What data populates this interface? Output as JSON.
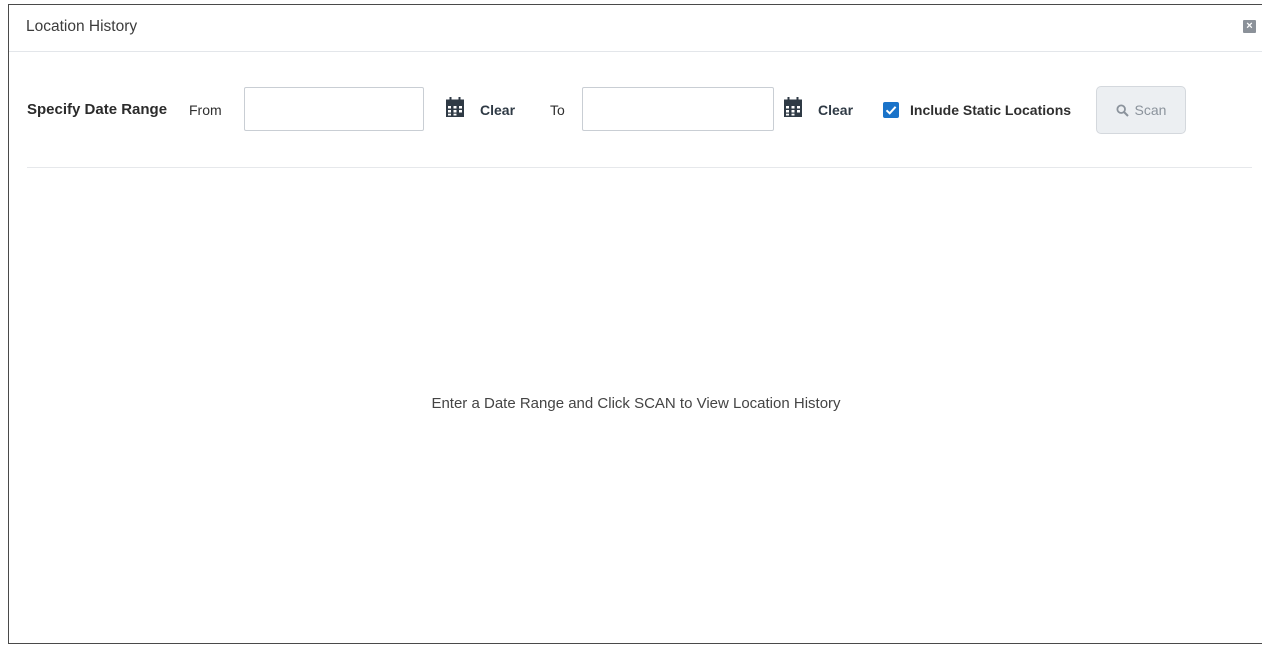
{
  "window": {
    "title": "Location History",
    "close_icon": "close-icon"
  },
  "filters": {
    "section_label": "Specify Date Range",
    "from_label": "From",
    "from_value": "",
    "from_placeholder": "",
    "to_label": "To",
    "to_value": "",
    "to_placeholder": "",
    "clear_label": "Clear",
    "calendar_icon": "calendar-icon",
    "include_static": {
      "label": "Include Static Locations",
      "checked": true
    },
    "scan_button": {
      "label": "Scan",
      "icon": "search-icon",
      "enabled": false
    }
  },
  "content": {
    "empty_message": "Enter a Date Range and Click SCAN to View Location History"
  },
  "colors": {
    "accent": "#1a73c9",
    "disabled_button_bg": "#eceff2",
    "disabled_button_text": "#8b939c"
  }
}
